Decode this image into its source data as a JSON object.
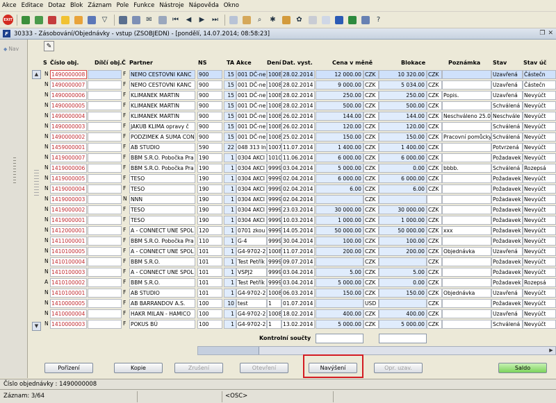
{
  "menu": [
    "Akce",
    "Editace",
    "Dotaz",
    "Blok",
    "Záznam",
    "Pole",
    "Funkce",
    "Nástroje",
    "Nápověda",
    "Okno"
  ],
  "toolbar": {
    "exit_label": "EXIT"
  },
  "window": {
    "title": "30333 - Zásobování/Objednávky - vstup (ZSOBJEDN) - [pondělí, 14.07.2014; 08:58:23]"
  },
  "nav": {
    "label": "Nav"
  },
  "columns": {
    "s": "S",
    "cislo": "Číslo obj.",
    "dilci": "Dílčí obj.",
    "c": "Č",
    "partner": "Partner",
    "ns": "NS",
    "ta": "TA",
    "akce": "Akce",
    "deni": "Dení",
    "datvyst": "Dat. vyst.",
    "cena": "Cena v měně",
    "blokace": "Blokace",
    "poznamka": "Poznámka",
    "stav": "Stav",
    "stavuc": "Stav úč"
  },
  "rows": [
    {
      "s": "N",
      "cislo": "1490000008",
      "c": "F",
      "partner": "NEMO CESTOVNI KANC",
      "ns": "900",
      "ta": "15",
      "akce": "001 DČ-ne",
      "deni": "1008",
      "dat": "28.02.2014",
      "cena": "12 000.00",
      "mena": "CZK",
      "blokace": "10 320.00",
      "bmena": "CZK",
      "pozn": "",
      "stav": "Uzavřená",
      "stavuc": "Částečn"
    },
    {
      "s": "N",
      "cislo": "1490000007",
      "c": "F",
      "partner": "NEMO CESTOVNI KANC",
      "ns": "900",
      "ta": "15",
      "akce": "001 DČ-ne",
      "deni": "1008",
      "dat": "28.02.2014",
      "cena": "9 000.00",
      "mena": "CZK",
      "blokace": "5 034.00",
      "bmena": "CZK",
      "pozn": "",
      "stav": "Uzavřená",
      "stavuc": "Částečn"
    },
    {
      "s": "N",
      "cislo": "1490000006",
      "c": "F",
      "partner": "KLIMANEK MARTIN",
      "ns": "900",
      "ta": "15",
      "akce": "001 DČ-ne",
      "deni": "1008",
      "dat": "28.02.2014",
      "cena": "250.00",
      "mena": "CZK",
      "blokace": "250.00",
      "bmena": "CZK",
      "pozn": "Popis.",
      "stav": "Uzavřená",
      "stavuc": "Nevyúčt"
    },
    {
      "s": "N",
      "cislo": "1490000005",
      "c": "F",
      "partner": "KLIMANEK MARTIN",
      "ns": "900",
      "ta": "15",
      "akce": "001 DČ-ne",
      "deni": "1008",
      "dat": "28.02.2014",
      "cena": "500.00",
      "mena": "CZK",
      "blokace": "500.00",
      "bmena": "CZK",
      "pozn": "",
      "stav": "Schválená",
      "stavuc": "Nevyúčt"
    },
    {
      "s": "N",
      "cislo": "1490000004",
      "c": "F",
      "partner": "KLIMANEK MARTIN",
      "ns": "900",
      "ta": "15",
      "akce": "001 DČ-ne",
      "deni": "1008",
      "dat": "26.02.2014",
      "cena": "144.00",
      "mena": "CZK",
      "blokace": "144.00",
      "bmena": "CZK",
      "pozn": "Neschváleno 25.0",
      "stav": "Neschvále",
      "stavuc": "Nevyúčt"
    },
    {
      "s": "N",
      "cislo": "1490000003",
      "c": "F",
      "partner": "JAKUB KLIMA opravy č",
      "ns": "900",
      "ta": "15",
      "akce": "001 DČ-ne",
      "deni": "1008",
      "dat": "26.02.2014",
      "cena": "120.00",
      "mena": "CZK",
      "blokace": "120.00",
      "bmena": "CZK",
      "pozn": "",
      "stav": "Schválená",
      "stavuc": "Nevyúčt"
    },
    {
      "s": "N",
      "cislo": "1490000002",
      "c": "F",
      "partner": "PODZIMEK A SUMA CON",
      "ns": "900",
      "ta": "15",
      "akce": "001 DČ-ne",
      "deni": "1008",
      "dat": "25.02.2014",
      "cena": "150.00",
      "mena": "CZK",
      "blokace": "150.00",
      "bmena": "CZK",
      "pozn": "Pracovní pomůcky",
      "stav": "Schválená",
      "stavuc": "Nevyúčt"
    },
    {
      "s": "N",
      "cislo": "1459000001",
      "c": "F",
      "partner": "AB STUDIO",
      "ns": "590",
      "ta": "22",
      "akce": "048 313 In",
      "deni": "1007",
      "dat": "11.07.2014",
      "cena": "1 400.00",
      "mena": "CZK",
      "blokace": "1 400.00",
      "bmena": "CZK",
      "pozn": "",
      "stav": "Potvrzená",
      "stavuc": "Nevyúčt"
    },
    {
      "s": "N",
      "cislo": "1419000007",
      "c": "F",
      "partner": "BBM S.R.O. Pobočka Pra",
      "ns": "190",
      "ta": "1",
      "akce": "0304 AKCI",
      "deni": "1010",
      "dat": "11.06.2014",
      "cena": "6 000.00",
      "mena": "CZK",
      "blokace": "6 000.00",
      "bmena": "CZK",
      "pozn": "",
      "stav": "Požadavek",
      "stavuc": "Nevyúčt"
    },
    {
      "s": "N",
      "cislo": "1419000006",
      "c": "F",
      "partner": "BBM S.R.O. Pobočka Pra",
      "ns": "190",
      "ta": "1",
      "akce": "0304 AKCI",
      "deni": "9999",
      "dat": "03.04.2014",
      "cena": "5 000.00",
      "mena": "CZK",
      "blokace": "0.00",
      "bmena": "CZK",
      "pozn": "bbbb.",
      "stav": "Schválená",
      "stavuc": "Rozepsá"
    },
    {
      "s": "N",
      "cislo": "1419000005",
      "c": "F",
      "partner": "TESO",
      "ns": "190",
      "ta": "1",
      "akce": "0304 AKCI",
      "deni": "9999",
      "dat": "02.04.2014",
      "cena": "6 000.00",
      "mena": "CZK",
      "blokace": "6 000.00",
      "bmena": "CZK",
      "pozn": "",
      "stav": "Požadavek",
      "stavuc": "Nevyúčt"
    },
    {
      "s": "N",
      "cislo": "1419000004",
      "c": "F",
      "partner": "TESO",
      "ns": "190",
      "ta": "1",
      "akce": "0304 AKCI",
      "deni": "9999",
      "dat": "02.04.2014",
      "cena": "6.00",
      "mena": "CZK",
      "blokace": "6.00",
      "bmena": "CZK",
      "pozn": "",
      "stav": "Požadavek",
      "stavuc": "Nevyúčt"
    },
    {
      "s": "N",
      "cislo": "1419000003",
      "c": "N",
      "partner": "NNN",
      "ns": "190",
      "ta": "1",
      "akce": "0304 AKCI",
      "deni": "9999",
      "dat": "02.04.2014",
      "cena": "",
      "mena": "CZK",
      "blokace": "",
      "bmena": "",
      "pozn": "",
      "stav": "Požadavek",
      "stavuc": "Nevyúčt"
    },
    {
      "s": "N",
      "cislo": "1419000002",
      "c": "F",
      "partner": "TESO",
      "ns": "190",
      "ta": "1",
      "akce": "0304 AKCI",
      "deni": "9999",
      "dat": "23.03.2014",
      "cena": "30 000.00",
      "mena": "CZK",
      "blokace": "30 000.00",
      "bmena": "CZK",
      "pozn": "",
      "stav": "Požadavek",
      "stavuc": "Nevyúčt"
    },
    {
      "s": "N",
      "cislo": "1419000001",
      "c": "F",
      "partner": "TESO",
      "ns": "190",
      "ta": "1",
      "akce": "0304 AKCI",
      "deni": "9999",
      "dat": "10.03.2014",
      "cena": "1 000.00",
      "mena": "CZK",
      "blokace": "1 000.00",
      "bmena": "CZK",
      "pozn": "",
      "stav": "Požadavek",
      "stavuc": "Nevyúčt"
    },
    {
      "s": "N",
      "cislo": "1412000001",
      "c": "F",
      "partner": "A - CONNECT UNE SPOL",
      "ns": "120",
      "ta": "1",
      "akce": "0701 zkou",
      "deni": "9999",
      "dat": "14.05.2014",
      "cena": "50 000.00",
      "mena": "CZK",
      "blokace": "50 000.00",
      "bmena": "CZK",
      "pozn": "xxx",
      "stav": "Požadavek",
      "stavuc": "Nevyúčt"
    },
    {
      "s": "N",
      "cislo": "1411000001",
      "c": "F",
      "partner": "BBM S.R.O. Pobočka Pra",
      "ns": "110",
      "ta": "1",
      "akce": "G-4",
      "deni": "9999",
      "dat": "30.04.2014",
      "cena": "100.00",
      "mena": "CZK",
      "blokace": "100.00",
      "bmena": "CZK",
      "pozn": "",
      "stav": "Požadavek",
      "stavuc": "Nevyúčt"
    },
    {
      "s": "N",
      "cislo": "1410100005",
      "c": "F",
      "partner": "A - CONNECT UNE SPOL",
      "ns": "101",
      "ta": "1",
      "akce": "G4-9702-2",
      "deni": "1008",
      "dat": "11.07.2014",
      "cena": "200.00",
      "mena": "CZK",
      "blokace": "200.00",
      "bmena": "CZK",
      "pozn": "Objednávka",
      "stav": "Uzavřená",
      "stavuc": "Nevyúčt"
    },
    {
      "s": "N",
      "cislo": "1410100004",
      "c": "F",
      "partner": "BBM S.R.O.",
      "ns": "101",
      "ta": "1",
      "akce": "Test Petřík",
      "deni": "9999",
      "dat": "09.07.2014",
      "cena": "",
      "mena": "CZK",
      "blokace": "",
      "bmena": "CZK",
      "pozn": "",
      "stav": "Požadavek",
      "stavuc": "Nevyúčt"
    },
    {
      "s": "N",
      "cislo": "1410100003",
      "c": "F",
      "partner": "A - CONNECT UNE SPOL",
      "ns": "101",
      "ta": "1",
      "akce": "VSPJ2",
      "deni": "9999",
      "dat": "03.04.2014",
      "cena": "5.00",
      "mena": "CZK",
      "blokace": "5.00",
      "bmena": "CZK",
      "pozn": "",
      "stav": "Požadavek",
      "stavuc": "Nevyúčt"
    },
    {
      "s": "A",
      "cislo": "1410100002",
      "c": "F",
      "partner": "BBM S.R.O.",
      "ns": "101",
      "ta": "1",
      "akce": "Test Petřík",
      "deni": "9999",
      "dat": "03.04.2014",
      "cena": "5 000.00",
      "mena": "CZK",
      "blokace": "0.00",
      "bmena": "CZK",
      "pozn": "",
      "stav": "Požadavek",
      "stavuc": "Rozepsá"
    },
    {
      "s": "N",
      "cislo": "1410100001",
      "c": "F",
      "partner": "AB STUDIO",
      "ns": "101",
      "ta": "1",
      "akce": "G4-9702-2",
      "deni": "1008",
      "dat": "06.03.2014",
      "cena": "150.00",
      "mena": "CZK",
      "blokace": "150.00",
      "bmena": "CZK",
      "pozn": "Objednávka",
      "stav": "Uzavřená",
      "stavuc": "Nevyúčt"
    },
    {
      "s": "N",
      "cislo": "1410000005",
      "c": "F",
      "partner": "AB BARRANDOV A.S.",
      "ns": "100",
      "ta": "10",
      "akce": "test",
      "deni": "1",
      "dat": "01.07.2014",
      "cena": "",
      "mena": "USD",
      "blokace": "",
      "bmena": "CZK",
      "pozn": "",
      "stav": "Požadavek",
      "stavuc": "Nevyúčt"
    },
    {
      "s": "N",
      "cislo": "1410000004",
      "c": "F",
      "partner": "HAKR MILAN - HAMICO",
      "ns": "100",
      "ta": "1",
      "akce": "G4-9702-2",
      "deni": "1008",
      "dat": "18.02.2014",
      "cena": "400.00",
      "mena": "CZK",
      "blokace": "400.00",
      "bmena": "CZK",
      "pozn": "",
      "stav": "Uzavřená",
      "stavuc": "Nevyúčt"
    },
    {
      "s": "N",
      "cislo": "1410000003",
      "c": "F",
      "partner": "POKUS BÚ",
      "ns": "100",
      "ta": "1",
      "akce": "G4-9702-2",
      "deni": "1",
      "dat": "13.02.2014",
      "cena": "5 000.00",
      "mena": "CZK",
      "blokace": "5 000.00",
      "bmena": "CZK",
      "pozn": "",
      "stav": "Schválená",
      "stavuc": "Nevyúčt"
    }
  ],
  "totals": {
    "label": "Kontrolní součty"
  },
  "buttons": {
    "porizeni": "Pořízení",
    "kopie": "Kopie",
    "zruseni": "Zrušení",
    "otevreni": "Otevření",
    "navyseni": "Navýšení",
    "opr": "Opr. uzav.",
    "saldo": "Saldo"
  },
  "status": {
    "field": "Číslo objednávky : 1490000008",
    "record": "Záznam: 3/64",
    "osc": "<OSC>"
  },
  "colors": {
    "highlight": "#d31b22",
    "saldo": "#7cd35b",
    "selected_row": "#cfe1fb"
  }
}
